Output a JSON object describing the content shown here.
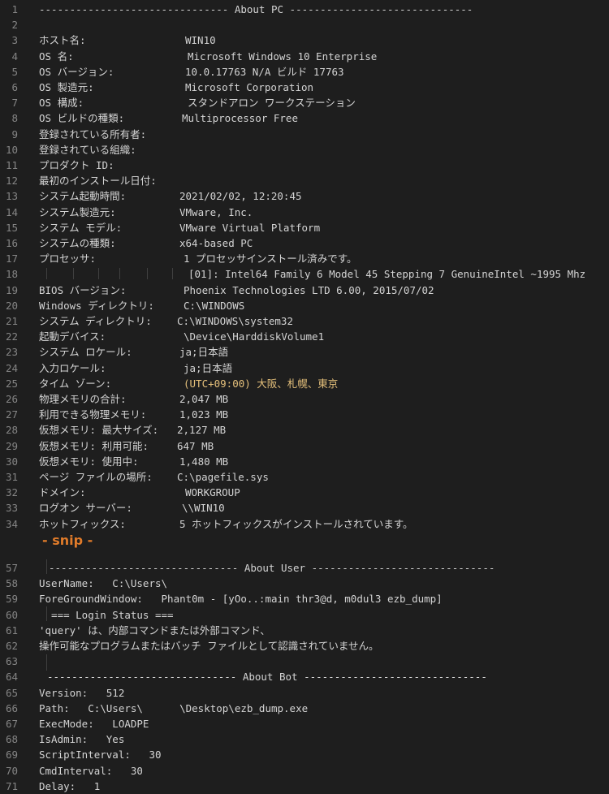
{
  "colors": {
    "background": "#1e1e1e",
    "text": "#d4d4d4",
    "line_number": "#858585",
    "snip": "#e07b2a"
  },
  "snip_label": "- snip -",
  "lines": [
    {
      "n": "1",
      "text": "------------------------------- About PC ------------------------------",
      "value": ""
    },
    {
      "n": "2",
      "text": "",
      "value": ""
    },
    {
      "n": "3",
      "text": "ホスト名:",
      "value": "WIN10"
    },
    {
      "n": "4",
      "text": "OS 名:",
      "value": "Microsoft Windows 10 Enterprise"
    },
    {
      "n": "5",
      "text": "OS バージョン:",
      "value": "10.0.17763 N/A ビルド 17763"
    },
    {
      "n": "6",
      "text": "OS 製造元:",
      "value": "Microsoft Corporation"
    },
    {
      "n": "7",
      "text": "OS 構成:",
      "value": "スタンドアロン ワークステーション"
    },
    {
      "n": "8",
      "text": "OS ビルドの種類:",
      "value": "Multiprocessor Free"
    },
    {
      "n": "9",
      "text": "登録されている所有者:",
      "value": ""
    },
    {
      "n": "10",
      "text": "登録されている組織:",
      "value": ""
    },
    {
      "n": "11",
      "text": "プロダクト ID:",
      "value": ""
    },
    {
      "n": "12",
      "text": "最初のインストール日付:",
      "value": ""
    },
    {
      "n": "13",
      "text": "システム起動時間:",
      "value": "2021/02/02, 12:20:45"
    },
    {
      "n": "14",
      "text": "システム製造元:",
      "value": "VMware, Inc."
    },
    {
      "n": "15",
      "text": "システム モデル:",
      "value": "VMware Virtual Platform"
    },
    {
      "n": "16",
      "text": "システムの種類:",
      "value": "x64-based PC"
    },
    {
      "n": "17",
      "text": "プロセッサ:",
      "value": "1 プロセッサインストール済みです。"
    },
    {
      "n": "18",
      "text": "",
      "value": "[01]: Intel64 Family 6 Model 45 Stepping 7 GenuineIntel ~1995 Mhz"
    },
    {
      "n": "19",
      "text": "BIOS バージョン:",
      "value": "Phoenix Technologies LTD 6.00, 2015/07/02"
    },
    {
      "n": "20",
      "text": "Windows ディレクトリ:",
      "value": "C:\\WINDOWS"
    },
    {
      "n": "21",
      "text": "システム ディレクトリ:",
      "value": "C:\\WINDOWS\\system32"
    },
    {
      "n": "22",
      "text": "起動デバイス:",
      "value": "\\Device\\HarddiskVolume1"
    },
    {
      "n": "23",
      "text": "システム ロケール:",
      "value": "ja;日本語"
    },
    {
      "n": "24",
      "text": "入力ロケール:",
      "value": "ja;日本語"
    },
    {
      "n": "25",
      "text": "タイム ゾーン:",
      "value": "(UTC+09:00) 大阪、札幌、東京"
    },
    {
      "n": "26",
      "text": "物理メモリの合計:",
      "value": "2,047 MB"
    },
    {
      "n": "27",
      "text": "利用できる物理メモリ:",
      "value": "1,023 MB"
    },
    {
      "n": "28",
      "text": "仮想メモリ: 最大サイズ:",
      "value": "2,127 MB"
    },
    {
      "n": "29",
      "text": "仮想メモリ: 利用可能:",
      "value": "647 MB"
    },
    {
      "n": "30",
      "text": "仮想メモリ: 使用中:",
      "value": "1,480 MB"
    },
    {
      "n": "31",
      "text": "ページ ファイルの場所:",
      "value": "C:\\pagefile.sys"
    },
    {
      "n": "32",
      "text": "ドメイン:",
      "value": "WORKGROUP"
    },
    {
      "n": "33",
      "text": "ログオン サーバー:",
      "value": "\\\\WIN10"
    },
    {
      "n": "34",
      "text": "ホットフィックス:",
      "value": "5 ホットフィックスがインストールされています。"
    },
    {
      "n": "57",
      "text": "------------------------------- About User ------------------------------",
      "value": ""
    },
    {
      "n": "58",
      "text": "UserName:   C:\\Users\\",
      "value": ""
    },
    {
      "n": "59",
      "text": "ForeGroundWindow:   Phant0m - [yOo..:main thr3@d, m0dul3 ezb_dump]",
      "value": ""
    },
    {
      "n": "60",
      "text": "  === Login Status ===",
      "value": ""
    },
    {
      "n": "61",
      "text": "'query' は、内部コマンドまたは外部コマンド、",
      "value": ""
    },
    {
      "n": "62",
      "text": "操作可能なプログラムまたはバッチ ファイルとして認識されていません。",
      "value": ""
    },
    {
      "n": "63",
      "text": "",
      "value": ""
    },
    {
      "n": "64",
      "text": "------------------------------- About Bot ------------------------------",
      "value": ""
    },
    {
      "n": "65",
      "text": "Version:   512",
      "value": ""
    },
    {
      "n": "66",
      "text": "Path:   C:\\Users\\      \\Desktop\\ezb_dump.exe",
      "value": ""
    },
    {
      "n": "67",
      "text": "ExecMode:   LOADPE",
      "value": ""
    },
    {
      "n": "68",
      "text": "IsAdmin:   Yes",
      "value": ""
    },
    {
      "n": "69",
      "text": "ScriptInterval:   30",
      "value": ""
    },
    {
      "n": "70",
      "text": "CmdInterval:   30",
      "value": ""
    },
    {
      "n": "71",
      "text": "Delay:   1",
      "value": ""
    }
  ]
}
